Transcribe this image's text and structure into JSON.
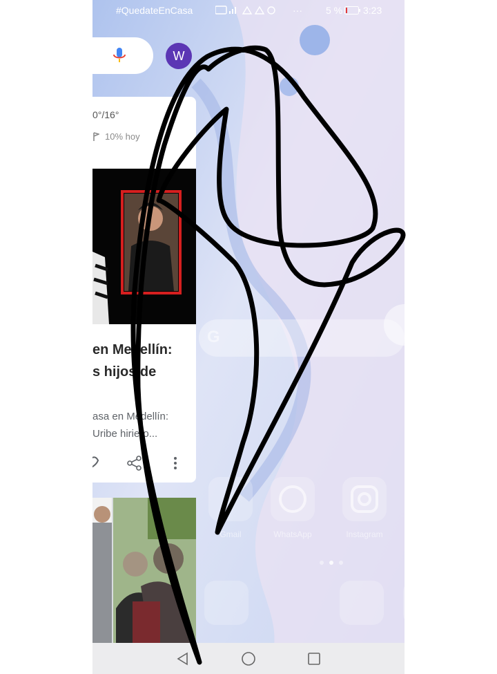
{
  "status_bar": {
    "left_text": "#QuedateEnCasa",
    "battery_percent": "5 %",
    "time": "3:23"
  },
  "feed": {
    "avatar_letter": "W",
    "weather": {
      "temp_range": "0°/16°",
      "rain_chance": "10% hoy"
    },
    "news": {
      "headline": "en Medellín:\ns hijos de",
      "snippet": "asa en Medellín:\n Uribe hiriero..."
    }
  },
  "homescreen": {
    "apps": [
      "Gmail",
      "WhatsApp",
      "Instagram"
    ]
  },
  "colors": {
    "accent": "#5b36b4",
    "ink": "#000000",
    "nav_bar": "#ececee"
  }
}
